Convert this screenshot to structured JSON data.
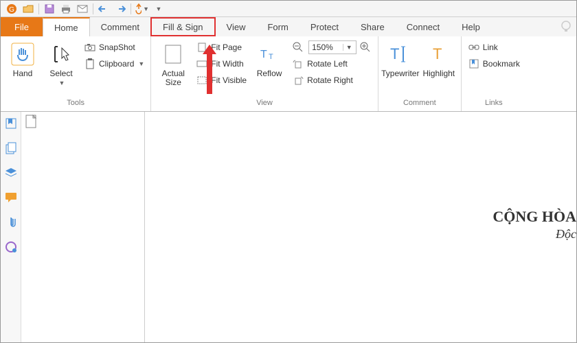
{
  "qat": {
    "icons": [
      "app",
      "open",
      "save",
      "print",
      "email",
      "undo",
      "redo",
      "touch",
      "more"
    ]
  },
  "tabs": {
    "file": "File",
    "items": [
      "Home",
      "Comment",
      "Fill & Sign",
      "View",
      "Form",
      "Protect",
      "Share",
      "Connect",
      "Help"
    ],
    "active": "Home",
    "highlighted": "Fill & Sign"
  },
  "ribbon": {
    "tools_label": "Tools",
    "hand": "Hand",
    "select": "Select",
    "snapshot": "SnapShot",
    "clipboard": "Clipboard",
    "view_label": "View",
    "actual_size": "Actual\nSize",
    "fit_page": "Fit Page",
    "fit_width": "Fit Width",
    "fit_visible": "Fit Visible",
    "reflow": "Reflow",
    "zoom_value": "150%",
    "rotate_left": "Rotate Left",
    "rotate_right": "Rotate Right",
    "comment_label": "Comment",
    "typewriter": "Typewriter",
    "highlight": "Highlight",
    "links_label": "Links",
    "link": "Link",
    "bookmark": "Bookmark"
  },
  "sidebar": {
    "icons": [
      "bookmarks",
      "pages",
      "layers",
      "comments",
      "attachments",
      "signatures"
    ]
  },
  "document": {
    "heading": "CỘNG HÒA",
    "subheading": "Độc"
  }
}
